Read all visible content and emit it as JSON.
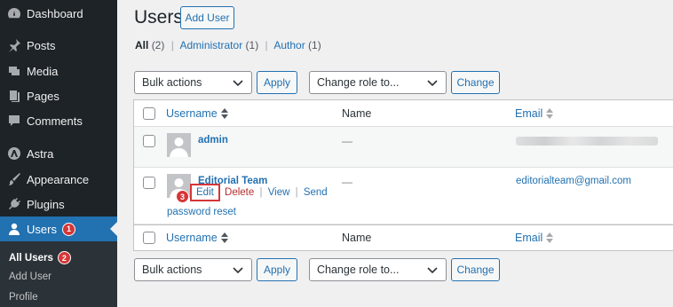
{
  "sidebar": {
    "items": [
      {
        "label": "Dashboard",
        "icon": "dashboard-icon"
      },
      {
        "label": "Posts",
        "icon": "pushpin-icon"
      },
      {
        "label": "Media",
        "icon": "media-icon"
      },
      {
        "label": "Pages",
        "icon": "pages-icon"
      },
      {
        "label": "Comments",
        "icon": "comments-icon"
      },
      {
        "label": "Astra",
        "icon": "astra-icon"
      },
      {
        "label": "Appearance",
        "icon": "brush-icon"
      },
      {
        "label": "Plugins",
        "icon": "plugin-icon"
      },
      {
        "label": "Users",
        "icon": "user-icon",
        "badge": "1"
      }
    ],
    "submenu": [
      {
        "label": "All Users",
        "badge": "2"
      },
      {
        "label": "Add User"
      },
      {
        "label": "Profile"
      }
    ]
  },
  "header": {
    "title": "Users",
    "add_button": "Add User"
  },
  "filters": {
    "all_label": "All",
    "all_count": "(2)",
    "admin_label": "Administrator",
    "admin_count": "(1)",
    "author_label": "Author",
    "author_count": "(1)",
    "separator": "|"
  },
  "bulk": {
    "selected": "Bulk actions",
    "apply_label": "Apply",
    "role_selected": "Change role to...",
    "change_label": "Change"
  },
  "table": {
    "columns": {
      "username": "Username",
      "name": "Name",
      "email": "Email"
    },
    "rows": [
      {
        "username": "admin",
        "name": "—",
        "email": ""
      },
      {
        "username": "Editorial Team",
        "name": "—",
        "email": "editorialteam@gmail.com"
      }
    ],
    "actions": {
      "edit": "Edit",
      "delete": "Delete",
      "view": "View",
      "send": "Send",
      "reset": "password reset",
      "edit_badge": "3",
      "pipe": "|"
    }
  },
  "colors": {
    "accent": "#2271b1",
    "sidebar": "#1d2327",
    "badge": "#d63638"
  }
}
